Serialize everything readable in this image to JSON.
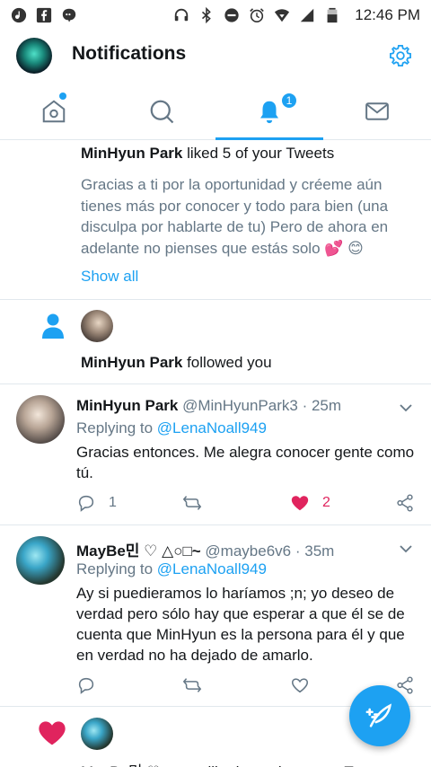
{
  "status_bar": {
    "time": "12:46 PM"
  },
  "header": {
    "title": "Notifications"
  },
  "tabs": {
    "notifications_badge": "1"
  },
  "like_summary": {
    "name": "MinHyun Park",
    "action": " liked 5 of your Tweets",
    "body": "Gracias a ti por la oportunidad y créeme aún tienes más por conocer  y todo para bien (una disculpa por hablarte de tu) Pero de ahora en adelante no pienses que estás solo 💕 😊",
    "show_all": "Show all"
  },
  "follow": {
    "name": "MinHyun Park",
    "action": " followed you"
  },
  "tweets": [
    {
      "name": "MinHyun Park",
      "handle": "@MinHyunPark3",
      "time": "25m",
      "reply_prefix": "Replying to ",
      "reply_to": "@LenaNoall949",
      "text": "Gracias entonces. Me alegra conocer gente como tú.",
      "reply_count": "1",
      "like_count": "2"
    },
    {
      "name": "MayBe민 ♡ △○□~",
      "handle": "@maybe6v6",
      "time": "35m",
      "reply_prefix": "Replying to ",
      "reply_to": "@LenaNoall949",
      "text": "Ay si puedieramos lo haríamos ;n; yo deseo de verdad pero sólo hay que esperar a que él se de cuenta que MinHyun es la persona para él y que en verdad no ha dejado de amarlo."
    }
  ],
  "bottom": {
    "cut_text": "MayBe민 ♡ △○□~ liked a reply to your Tweet"
  },
  "colors": {
    "accent": "#1da1f2",
    "like": "#e0245e",
    "muted": "#657786"
  }
}
